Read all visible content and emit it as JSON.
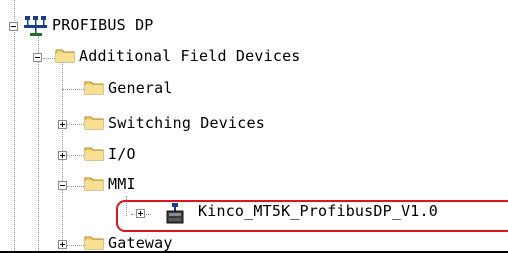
{
  "tree": {
    "root": {
      "label": "PROFIBUS DP",
      "icon": "network-icon"
    },
    "additional": {
      "label": "Additional Field Devices",
      "icon": "folder-icon"
    },
    "general": {
      "label": "General",
      "icon": "folder-icon"
    },
    "switching": {
      "label": "Switching Devices",
      "icon": "folder-icon"
    },
    "io": {
      "label": "I/O",
      "icon": "folder-icon"
    },
    "mmi": {
      "label": "MMI",
      "icon": "folder-icon"
    },
    "kinco": {
      "label": "Kinco_MT5K_ProfibusDP_V1.0",
      "icon": "device-icon"
    },
    "gateway": {
      "label": "Gateway",
      "icon": "folder-icon"
    }
  },
  "colors": {
    "highlight": "#e0141e",
    "folder": "#f2d16b"
  }
}
